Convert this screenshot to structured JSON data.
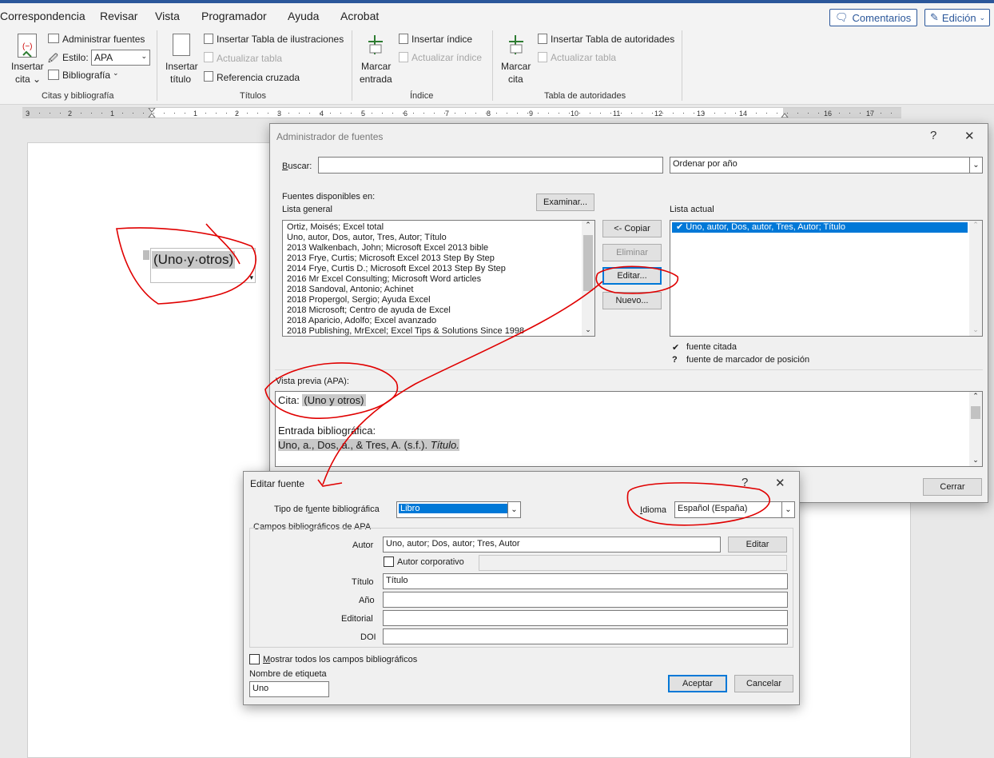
{
  "tabs": [
    "Correspondencia",
    "Revisar",
    "Vista",
    "Programador",
    "Ayuda",
    "Acrobat"
  ],
  "top_buttons": {
    "comments": "Comentarios",
    "editing": "Edición"
  },
  "ribbon": {
    "citas": {
      "insert_cite_1": "Insertar",
      "insert_cite_2": "cita",
      "manage_sources": "Administrar fuentes",
      "style_label": "Estilo:",
      "style_value": "APA",
      "bibliography": "Bibliografía",
      "group_label": "Citas y bibliografía"
    },
    "titulos": {
      "insert_caption_1": "Insertar",
      "insert_caption_2": "título",
      "insert_table_figures": "Insertar Tabla de ilustraciones",
      "update_table": "Actualizar tabla",
      "cross_ref": "Referencia cruzada",
      "group_label": "Títulos"
    },
    "indice": {
      "mark_entry_1": "Marcar",
      "mark_entry_2": "entrada",
      "insert_index": "Insertar índice",
      "update_index": "Actualizar índice",
      "group_label": "Índice"
    },
    "autoridades": {
      "mark_cite_1": "Marcar",
      "mark_cite_2": "cita",
      "insert_toa": "Insertar Tabla de autoridades",
      "update_table": "Actualizar tabla",
      "group_label": "Tabla de autoridades"
    }
  },
  "ruler_numbers": [
    "3",
    "2",
    "1",
    "1",
    "2",
    "3",
    "4",
    "5",
    "6",
    "7",
    "8",
    "9",
    "10",
    "11",
    "12",
    "13",
    "14",
    "16",
    "17"
  ],
  "document": {
    "citation": "(Uno·y·otros)"
  },
  "source_manager": {
    "title": "Administrador de fuentes",
    "help": "?",
    "close": "✕",
    "search_label": "Buscar:",
    "search_value": "",
    "sort_value": "Ordenar por año",
    "available_in": "Fuentes disponibles en:",
    "general_list": "Lista general",
    "browse": "Examinar...",
    "general_items": [
      "Ortiz, Moisés; Excel total",
      "Uno, autor, Dos, autor, Tres, Autor; Título",
      "2013 Walkenbach, John; Microsoft Excel 2013 bible",
      "2013 Frye, Curtis; Microsoft Excel 2013 Step By Step",
      "2014 Frye, Curtis D.; Microsoft Excel 2013 Step By Step",
      "2016 Mr Excel Consulting; Microsoft Word articles",
      "2018 Sandoval, Antonio; Achinet",
      "2018 Propergol, Sergio; Ayuda Excel",
      "2018 Microsoft; Centro de ayuda de Excel",
      "2018 Aparicio, Adolfo; Excel avanzado",
      "2018 Publishing, MrExcel; Excel Tips & Solutions Since 1998"
    ],
    "copy": "<- Copiar",
    "delete": "Eliminar",
    "edit": "Editar...",
    "new": "Nuevo...",
    "current_list": "Lista actual",
    "current_items": [
      "✔ Uno, autor, Dos, autor, Tres, Autor; Título"
    ],
    "legend_cited_mark": "✔",
    "legend_cited": "fuente citada",
    "legend_placeholder_mark": "?",
    "legend_placeholder": "fuente de marcador de posición",
    "preview_label": "Vista previa (APA):",
    "preview_cite_label": "Cita:",
    "preview_cite": "(Uno y otros)",
    "preview_bib_label": "Entrada bibliográfica:",
    "preview_bib": "Uno, a., Dos, a., & Tres, A. (s.f.).",
    "preview_bib_title": "Título.",
    "close_button": "Cerrar"
  },
  "edit_source": {
    "title": "Editar fuente",
    "help": "?",
    "close": "✕",
    "type_label": "Tipo de fuente bibliográfica",
    "type_value": "Libro",
    "language_label": "Idioma",
    "language_value": "Español (España)",
    "fields_group": "Campos bibliográficos de APA",
    "author_label": "Autor",
    "author_value": "Uno, autor; Dos, autor; Tres, Autor",
    "edit_button": "Editar",
    "corporate_author": "Autor corporativo",
    "title_label": "Título",
    "title_value": "Título",
    "year_label": "Año",
    "year_value": "",
    "publisher_label": "Editorial",
    "publisher_value": "",
    "doi_label": "DOI",
    "doi_value": "",
    "show_all": "Mostrar todos los campos bibliográficos",
    "tag_label": "Nombre de etiqueta",
    "tag_value": "Uno",
    "ok": "Aceptar",
    "cancel": "Cancelar"
  },
  "colors": {
    "accent": "#2b579a",
    "selection": "#0078d7",
    "annotation": "#e00000"
  }
}
